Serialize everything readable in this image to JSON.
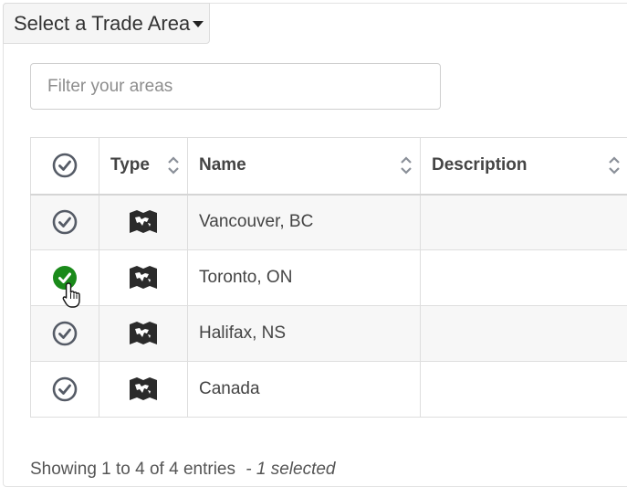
{
  "dropdown": {
    "label": "Select a Trade Area"
  },
  "filter": {
    "placeholder": "Filter your areas",
    "value": ""
  },
  "table": {
    "columns": [
      "Type",
      "Name",
      "Description"
    ],
    "rows": [
      {
        "name": "Vancouver, BC",
        "description": "",
        "selected": false
      },
      {
        "name": "Toronto, ON",
        "description": "",
        "selected": true
      },
      {
        "name": "Halifax, NS",
        "description": "",
        "selected": false
      },
      {
        "name": "Canada",
        "description": "",
        "selected": false
      }
    ]
  },
  "footer": {
    "entries_text": "Showing 1 to 4 of 4 entries",
    "selected_text": "- 1 selected"
  },
  "colors": {
    "selected_check": "#1a8a1a",
    "unselected_check": "#555b66",
    "map_icon": "#2b2b2b"
  },
  "icons": {
    "select_all": "check-circle-icon",
    "type": "map-icon",
    "sort": "sort-icon",
    "cursor": "hand-pointer-icon"
  }
}
